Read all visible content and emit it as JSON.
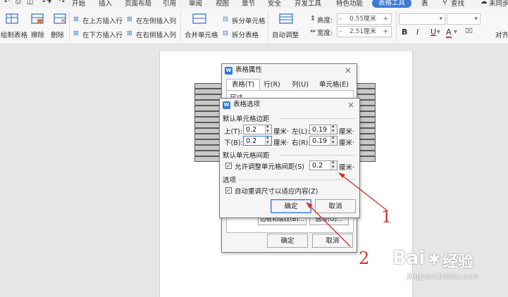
{
  "menubar": {
    "tabs": [
      "开始",
      "插入",
      "页面布局",
      "引用",
      "审阅",
      "视图",
      "章节",
      "安全",
      "开发工具",
      "特色功能",
      "表格工具",
      "表"
    ],
    "active_tab": "表格工具",
    "search": "查找",
    "sync": "未同步"
  },
  "ribbon": {
    "draw_table": "绘制表格",
    "erase": "擦除",
    "delete": "删除",
    "insert_above": "在上方插入行",
    "insert_below": "在下方插入行",
    "insert_left": "在左侧插入列",
    "insert_right": "在右侧插入列",
    "merge_cells": "合并单元格",
    "split_cells": "拆分单元格",
    "split_table": "拆分表格",
    "auto_adjust": "自动调整",
    "height_label": "高度:",
    "height_value": "0.55厘米",
    "width_label": "宽度:",
    "width_value": "2.51厘米",
    "minus": "-",
    "plus": "+",
    "bold": "B",
    "italic": "I",
    "underline": "U",
    "font_color": "A",
    "align": "对齐"
  },
  "table_properties": {
    "title": "表格属性",
    "tabs": [
      "表格(T)",
      "行(R)",
      "列(U)",
      "单元格(E)"
    ],
    "size_label": "尺寸",
    "borders_button": "边框和底纹(B)...",
    "options_button": "选项(O)...",
    "ok": "确定",
    "cancel": "取消"
  },
  "table_options": {
    "title": "表格选项",
    "margins_group": "默认单元格边距",
    "top_label": "上(T):",
    "top_value": "0.2",
    "left_label": "左(L):",
    "left_value": "0.19",
    "bottom_label": "下(B):",
    "bottom_value": "0.2",
    "right_label": "右(R):",
    "right_value": "0.19",
    "unit": "厘米·",
    "spacing_group": "默认单元格间距",
    "allow_spacing_label": "允许调整单元格间距(S)",
    "allow_spacing_checked": true,
    "spacing_value": "0.2",
    "options_group": "选项",
    "auto_resize_label": "自动重调尺寸以适应内容(Z)",
    "auto_resize_checked": true,
    "ok": "确定",
    "cancel": "取消"
  },
  "annotations": [
    "1",
    "2"
  ],
  "watermark": {
    "main": "Bai",
    "paw": "du",
    "cn": "经验",
    "url": "jingyan.baidu.com"
  },
  "colors": {
    "accent": "#3a7bd5",
    "annotation": "#d0312d"
  }
}
